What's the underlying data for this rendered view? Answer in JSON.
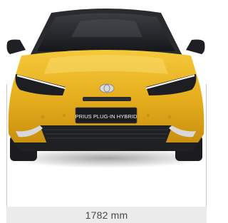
{
  "car": {
    "badge_text": "PRIUS PLUG-IN HYBRID",
    "body_color": "#e8b321",
    "trim_color": "#2b2b2d"
  },
  "dimension": {
    "label": "1782 mm"
  }
}
